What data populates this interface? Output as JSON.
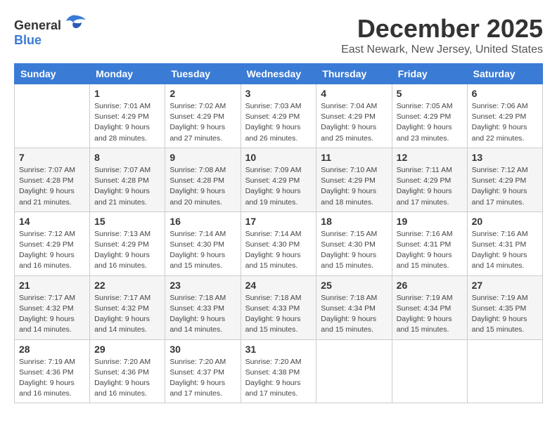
{
  "header": {
    "logo_general": "General",
    "logo_blue": "Blue",
    "month_title": "December 2025",
    "location": "East Newark, New Jersey, United States"
  },
  "days_of_week": [
    "Sunday",
    "Monday",
    "Tuesday",
    "Wednesday",
    "Thursday",
    "Friday",
    "Saturday"
  ],
  "weeks": [
    [
      {
        "day": "",
        "info": ""
      },
      {
        "day": "1",
        "info": "Sunrise: 7:01 AM\nSunset: 4:29 PM\nDaylight: 9 hours\nand 28 minutes."
      },
      {
        "day": "2",
        "info": "Sunrise: 7:02 AM\nSunset: 4:29 PM\nDaylight: 9 hours\nand 27 minutes."
      },
      {
        "day": "3",
        "info": "Sunrise: 7:03 AM\nSunset: 4:29 PM\nDaylight: 9 hours\nand 26 minutes."
      },
      {
        "day": "4",
        "info": "Sunrise: 7:04 AM\nSunset: 4:29 PM\nDaylight: 9 hours\nand 25 minutes."
      },
      {
        "day": "5",
        "info": "Sunrise: 7:05 AM\nSunset: 4:29 PM\nDaylight: 9 hours\nand 23 minutes."
      },
      {
        "day": "6",
        "info": "Sunrise: 7:06 AM\nSunset: 4:29 PM\nDaylight: 9 hours\nand 22 minutes."
      }
    ],
    [
      {
        "day": "7",
        "info": "Sunrise: 7:07 AM\nSunset: 4:28 PM\nDaylight: 9 hours\nand 21 minutes."
      },
      {
        "day": "8",
        "info": "Sunrise: 7:07 AM\nSunset: 4:28 PM\nDaylight: 9 hours\nand 21 minutes."
      },
      {
        "day": "9",
        "info": "Sunrise: 7:08 AM\nSunset: 4:28 PM\nDaylight: 9 hours\nand 20 minutes."
      },
      {
        "day": "10",
        "info": "Sunrise: 7:09 AM\nSunset: 4:29 PM\nDaylight: 9 hours\nand 19 minutes."
      },
      {
        "day": "11",
        "info": "Sunrise: 7:10 AM\nSunset: 4:29 PM\nDaylight: 9 hours\nand 18 minutes."
      },
      {
        "day": "12",
        "info": "Sunrise: 7:11 AM\nSunset: 4:29 PM\nDaylight: 9 hours\nand 17 minutes."
      },
      {
        "day": "13",
        "info": "Sunrise: 7:12 AM\nSunset: 4:29 PM\nDaylight: 9 hours\nand 17 minutes."
      }
    ],
    [
      {
        "day": "14",
        "info": "Sunrise: 7:12 AM\nSunset: 4:29 PM\nDaylight: 9 hours\nand 16 minutes."
      },
      {
        "day": "15",
        "info": "Sunrise: 7:13 AM\nSunset: 4:29 PM\nDaylight: 9 hours\nand 16 minutes."
      },
      {
        "day": "16",
        "info": "Sunrise: 7:14 AM\nSunset: 4:30 PM\nDaylight: 9 hours\nand 15 minutes."
      },
      {
        "day": "17",
        "info": "Sunrise: 7:14 AM\nSunset: 4:30 PM\nDaylight: 9 hours\nand 15 minutes."
      },
      {
        "day": "18",
        "info": "Sunrise: 7:15 AM\nSunset: 4:30 PM\nDaylight: 9 hours\nand 15 minutes."
      },
      {
        "day": "19",
        "info": "Sunrise: 7:16 AM\nSunset: 4:31 PM\nDaylight: 9 hours\nand 15 minutes."
      },
      {
        "day": "20",
        "info": "Sunrise: 7:16 AM\nSunset: 4:31 PM\nDaylight: 9 hours\nand 14 minutes."
      }
    ],
    [
      {
        "day": "21",
        "info": "Sunrise: 7:17 AM\nSunset: 4:32 PM\nDaylight: 9 hours\nand 14 minutes."
      },
      {
        "day": "22",
        "info": "Sunrise: 7:17 AM\nSunset: 4:32 PM\nDaylight: 9 hours\nand 14 minutes."
      },
      {
        "day": "23",
        "info": "Sunrise: 7:18 AM\nSunset: 4:33 PM\nDaylight: 9 hours\nand 14 minutes."
      },
      {
        "day": "24",
        "info": "Sunrise: 7:18 AM\nSunset: 4:33 PM\nDaylight: 9 hours\nand 15 minutes."
      },
      {
        "day": "25",
        "info": "Sunrise: 7:18 AM\nSunset: 4:34 PM\nDaylight: 9 hours\nand 15 minutes."
      },
      {
        "day": "26",
        "info": "Sunrise: 7:19 AM\nSunset: 4:34 PM\nDaylight: 9 hours\nand 15 minutes."
      },
      {
        "day": "27",
        "info": "Sunrise: 7:19 AM\nSunset: 4:35 PM\nDaylight: 9 hours\nand 15 minutes."
      }
    ],
    [
      {
        "day": "28",
        "info": "Sunrise: 7:19 AM\nSunset: 4:36 PM\nDaylight: 9 hours\nand 16 minutes."
      },
      {
        "day": "29",
        "info": "Sunrise: 7:20 AM\nSunset: 4:36 PM\nDaylight: 9 hours\nand 16 minutes."
      },
      {
        "day": "30",
        "info": "Sunrise: 7:20 AM\nSunset: 4:37 PM\nDaylight: 9 hours\nand 17 minutes."
      },
      {
        "day": "31",
        "info": "Sunrise: 7:20 AM\nSunset: 4:38 PM\nDaylight: 9 hours\nand 17 minutes."
      },
      {
        "day": "",
        "info": ""
      },
      {
        "day": "",
        "info": ""
      },
      {
        "day": "",
        "info": ""
      }
    ]
  ]
}
